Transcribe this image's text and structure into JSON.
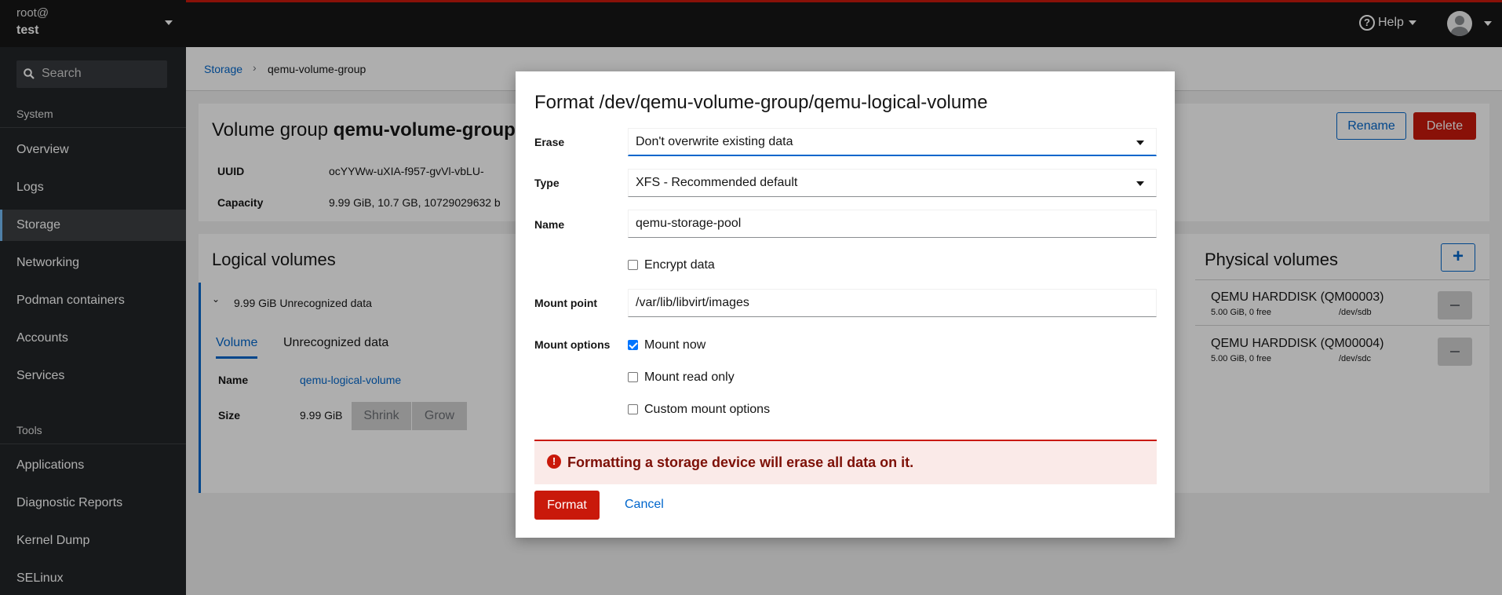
{
  "host": {
    "user": "root@",
    "name": "test"
  },
  "search": {
    "placeholder": "Search"
  },
  "sidebar": {
    "group_system": "System",
    "system_items": [
      "Overview",
      "Logs",
      "Storage",
      "Networking",
      "Podman containers",
      "Accounts",
      "Services"
    ],
    "group_tools": "Tools",
    "tools_items": [
      "Applications",
      "Diagnostic Reports",
      "Kernel Dump",
      "SELinux"
    ],
    "active": "Storage"
  },
  "topbar": {
    "help": "Help"
  },
  "breadcrumb": {
    "root": "Storage",
    "current": "qemu-volume-group"
  },
  "volume_group": {
    "title_prefix": "Volume group",
    "title_name": "qemu-volume-group",
    "rename": "Rename",
    "delete": "Delete",
    "uuid_label": "UUID",
    "uuid_value": "ocYYWw-uXIA-f957-gvVl-vbLU-",
    "capacity_label": "Capacity",
    "capacity_value": "9.99 GiB, 10.7 GB, 10729029632 b"
  },
  "logical_volumes": {
    "title": "Logical volumes",
    "row_summary": "9.99 GiB Unrecognized data",
    "tabs": [
      "Volume",
      "Unrecognized data"
    ],
    "name_label": "Name",
    "name_value": "qemu-logical-volume",
    "size_label": "Size",
    "size_value": "9.99 GiB",
    "shrink": "Shrink",
    "grow": "Grow"
  },
  "physical_volumes": {
    "title": "Physical volumes",
    "add": "+",
    "items": [
      {
        "name": "QEMU HARDDISK (QM00003)",
        "free": "5.00 GiB, 0 free",
        "device": "/dev/sdb"
      },
      {
        "name": "QEMU HARDDISK (QM00004)",
        "free": "5.00 GiB, 0 free",
        "device": "/dev/sdc"
      }
    ]
  },
  "modal": {
    "title": "Format /dev/qemu-volume-group/qemu-logical-volume",
    "erase_label": "Erase",
    "erase_value": "Don't overwrite existing data",
    "type_label": "Type",
    "type_value": "XFS - Recommended default",
    "name_label": "Name",
    "name_value": "qemu-storage-pool",
    "encrypt_label": "Encrypt data",
    "encrypt_checked": false,
    "mount_point_label": "Mount point",
    "mount_point_value": "/var/lib/libvirt/images",
    "mount_options_label": "Mount options",
    "mount_now": "Mount now",
    "mount_now_checked": true,
    "mount_read_only": "Mount read only",
    "mount_read_only_checked": false,
    "custom_mount_options": "Custom mount options",
    "custom_mount_options_checked": false,
    "warning": "Formatting a storage device will erase all data on it.",
    "format_button": "Format",
    "cancel_button": "Cancel"
  },
  "colors": {
    "danger": "#c9190b",
    "link": "#0066cc",
    "sidebar_bg": "#212427",
    "alert_bg": "#faeae8"
  }
}
